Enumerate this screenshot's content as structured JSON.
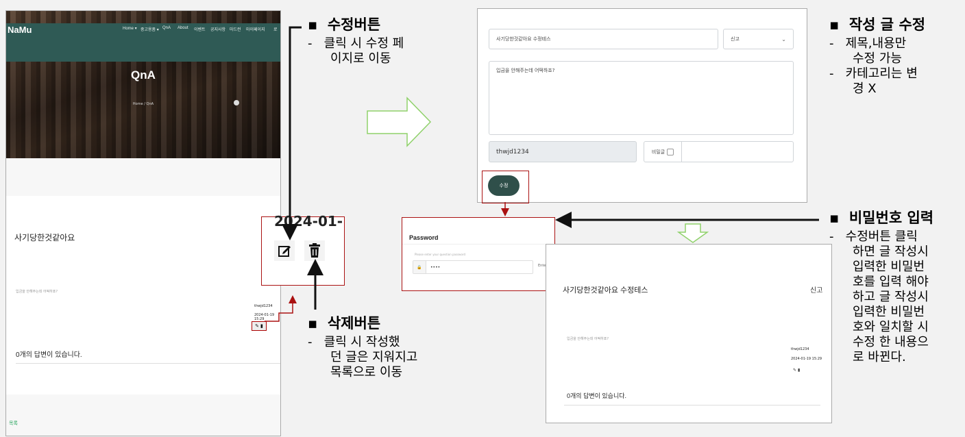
{
  "left_screen": {
    "brand": "NaMu",
    "nav": [
      "Home ▾",
      "중고용품 ▾",
      "QnA",
      "About",
      "이벤트",
      "공지사항",
      "마드런",
      "마이페이지",
      "로"
    ],
    "hero_title": "QnA",
    "breadcrumb": "Home / QnA",
    "post_title": "사기당한것같아요",
    "post_body": "입금을 안해주는데 어떡하죠?",
    "author": "thwjd1234",
    "date": "2024-01-19 15:29",
    "answers": "0개의 답변이 있습니다.",
    "list_link": "목록"
  },
  "zoom": {
    "date": "2024-01-"
  },
  "annotations": {
    "edit": {
      "title": "수정버튼",
      "lines": [
        "클릭 시 수정 페",
        "이지로 이동"
      ]
    },
    "delete": {
      "title": "삭제버튼",
      "lines": [
        "클릭 시 작성했",
        "던 글은 지워지고",
        "목록으로 이동"
      ]
    },
    "modify": {
      "title": "작성 글 수정",
      "lines": [
        "제목,내용만",
        "수정 가능",
        "카테고리는 변",
        "경 X"
      ]
    },
    "password": {
      "title": "비밀번호 입력",
      "lines": [
        "수정버튼 클릭",
        "하면 글 작성시",
        "입력한 비밀번",
        "호를 입력 해야",
        "하고 글 작성시",
        "입력한 비밀번",
        "호와 일치할 시",
        "수정 한 내용으",
        "로 바뀐다."
      ]
    }
  },
  "edit_form": {
    "title_value": "사기당한것같아요 수정테스",
    "category": "신고",
    "content_value": "입금을 안해주는데 어떡하죠?",
    "user": "thwjd1234",
    "secret_label": "비밀글",
    "submit": "수정"
  },
  "password_modal": {
    "title": "Password",
    "hint": "Please enter your question password",
    "value": "••••",
    "enter": "Enter"
  },
  "result_screen": {
    "post_title": "사기당한것같아요 수정테스",
    "category": "신고",
    "post_body": "입금을 안해주는데 어떡하죠?",
    "author": "thwjd1234",
    "date": "2024-01-19 15:29",
    "answers": "0개의 답변이 있습니다."
  },
  "colors": {
    "accent": "#2f5a55",
    "button": "#2f4f4a",
    "highlight": "#a11111",
    "flow_arrow": "#8fd16a"
  },
  "icons": [
    "edit-icon",
    "trash-icon",
    "lock-icon",
    "chevron-down-icon",
    "flow-arrow-icon"
  ]
}
